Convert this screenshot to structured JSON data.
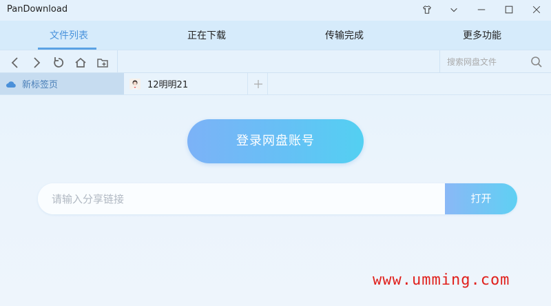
{
  "window": {
    "title": "PanDownload"
  },
  "nav": {
    "tabs": [
      {
        "label": "文件列表",
        "active": true
      },
      {
        "label": "正在下载",
        "active": false
      },
      {
        "label": "传输完成",
        "active": false
      },
      {
        "label": "更多功能",
        "active": false
      }
    ]
  },
  "toolbar": {
    "search": {
      "placeholder": "搜索网盘文件"
    }
  },
  "browser_tabs": [
    {
      "label": "新标签页",
      "icon": "cloud-icon",
      "active": true
    },
    {
      "label": "12明明21",
      "icon": "avatar",
      "active": false
    }
  ],
  "main": {
    "login_label": "登录网盘账号",
    "share": {
      "placeholder": "请输入分享链接",
      "value": ""
    },
    "open_label": "打开"
  },
  "watermark": "www.umming.com",
  "colors": {
    "accent": "#5ba2e4",
    "watermark": "#e0201c"
  }
}
